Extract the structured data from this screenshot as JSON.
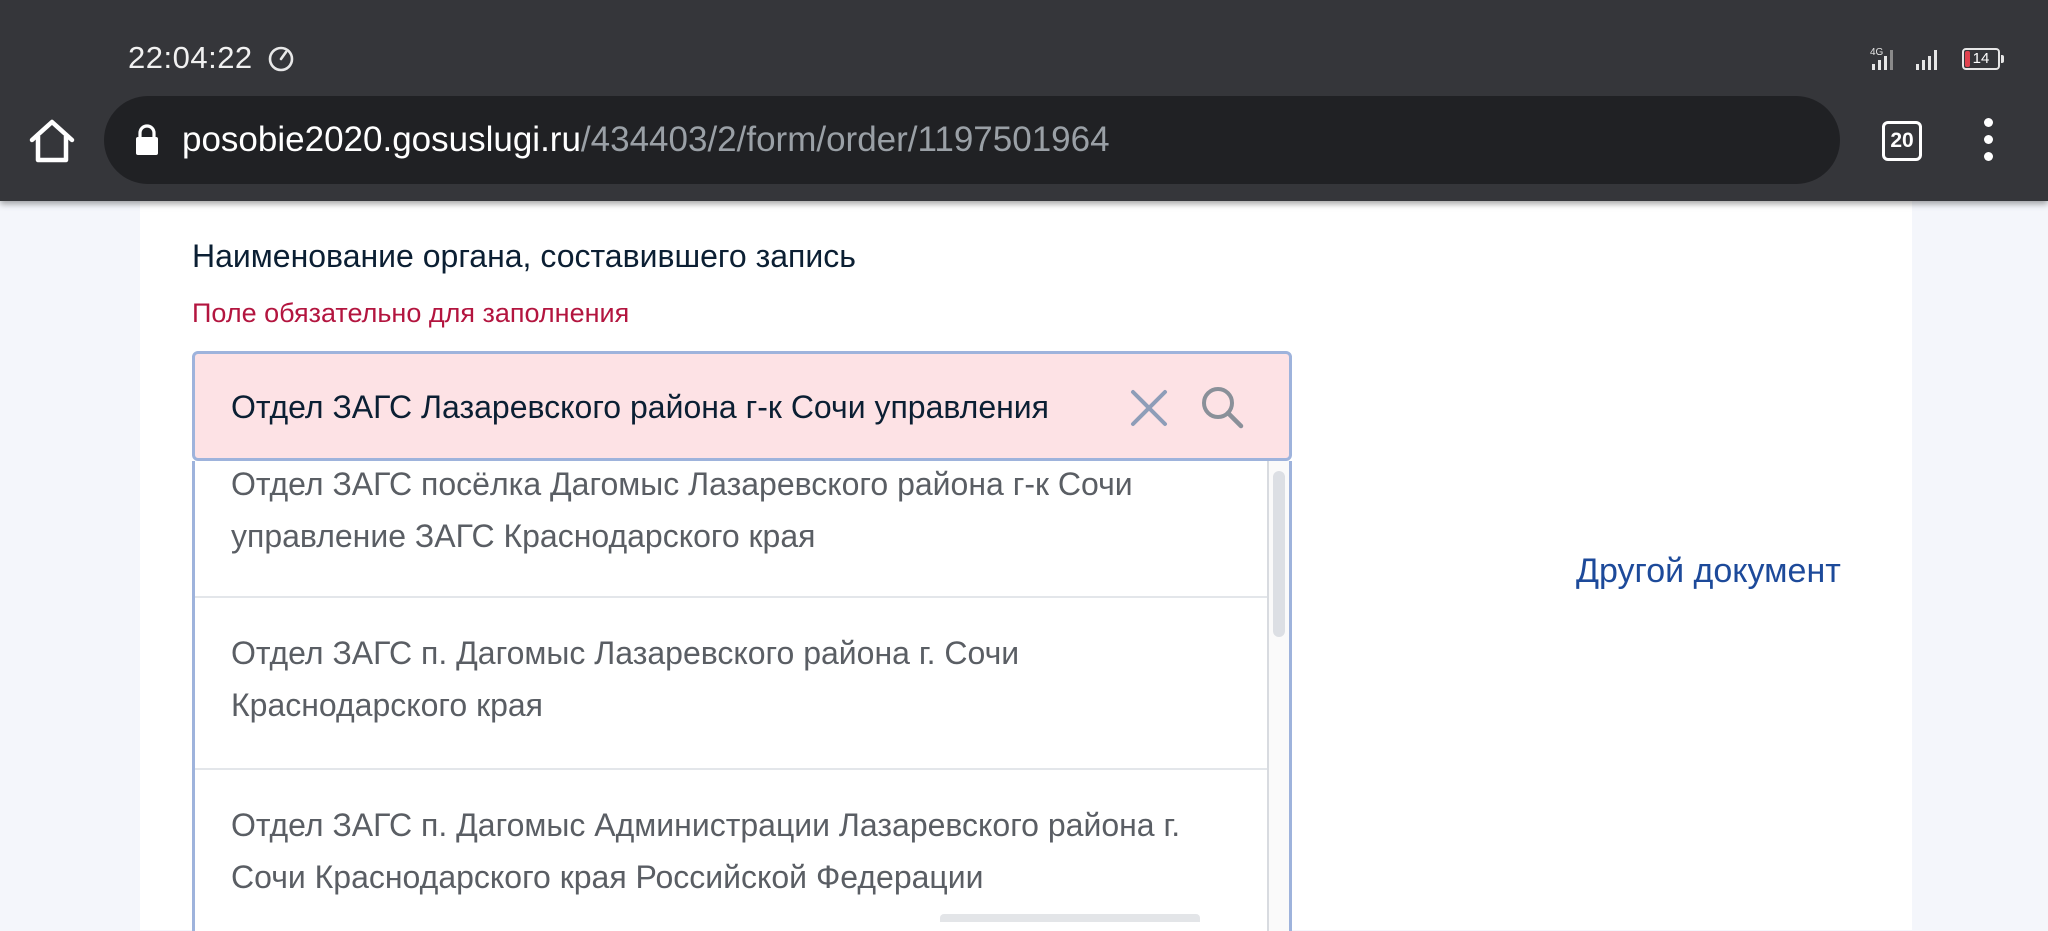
{
  "status_bar": {
    "time": "22:04:22",
    "network_label": "4G",
    "battery_level": "14"
  },
  "browser": {
    "url_host": "posobie2020.gosuslugi.ru",
    "url_path": "/434403/2/form/order/1197501964",
    "tab_count": "20"
  },
  "form": {
    "field_label": "Наименование органа, составившего запись",
    "error_text": "Поле обязательно для заполнения",
    "input_value": "Отдел ЗАГС Лазаревского района г-к Сочи управления",
    "options": [
      {
        "line1": "Отдел ЗАГС посёлка Дагомыс Лазаревского района г-к Сочи",
        "line2": "управление ЗАГС Краснодарского края"
      },
      {
        "line1": "Отдел ЗАГС п. Дагомыс Лазаревского района г. Сочи",
        "line2": "Краснодарского края"
      },
      {
        "line1": "Отдел ЗАГС п. Дагомыс Администрации Лазаревского района г.",
        "line2": "Сочи Краснодарского края Российской Федерации"
      }
    ],
    "other_document_link": "Другой документ"
  },
  "colors": {
    "chrome_bg": "#35363a",
    "input_error_bg": "#fde2e5",
    "input_border": "#9eb3dc",
    "error_text": "#b3153f",
    "link": "#1d4a9a"
  }
}
